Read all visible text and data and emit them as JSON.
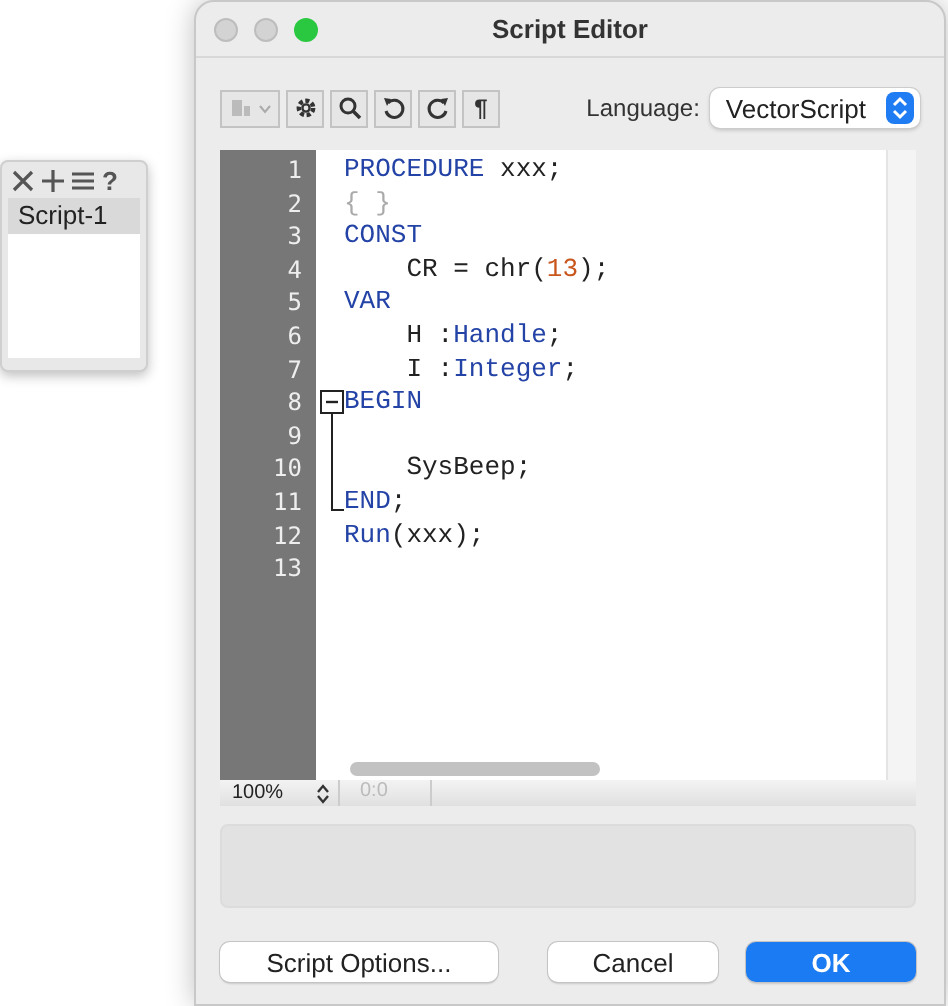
{
  "palette": {
    "help": "?",
    "items": [
      {
        "label": "Script-1",
        "selected": true
      }
    ]
  },
  "window": {
    "title": "Script Editor"
  },
  "toolbar": {
    "pilcrow": "¶",
    "language_label": "Language:",
    "language": "VectorScript"
  },
  "editor": {
    "lines": [
      {
        "number": "1",
        "kind": "plain",
        "tokens": [
          {
            "kind": "keyword",
            "text": "PROCEDURE"
          },
          {
            "kind": "plain",
            "text": " xxx;"
          }
        ]
      },
      {
        "number": "2",
        "kind": "plain",
        "tokens": [
          {
            "kind": "comment",
            "text": "{ }"
          }
        ]
      },
      {
        "number": "3",
        "kind": "plain",
        "tokens": [
          {
            "kind": "keyword",
            "text": "CONST"
          }
        ]
      },
      {
        "number": "4",
        "kind": "plain",
        "tokens": [
          {
            "kind": "plain",
            "text": "    CR = chr("
          },
          {
            "kind": "number",
            "text": "13"
          },
          {
            "kind": "plain",
            "text": ");"
          }
        ]
      },
      {
        "number": "5",
        "kind": "plain",
        "tokens": [
          {
            "kind": "keyword",
            "text": "VAR"
          }
        ]
      },
      {
        "number": "6",
        "kind": "plain",
        "tokens": [
          {
            "kind": "plain",
            "text": "    H :"
          },
          {
            "kind": "keyword",
            "text": "Handle"
          },
          {
            "kind": "plain",
            "text": ";"
          }
        ]
      },
      {
        "number": "7",
        "kind": "plain",
        "tokens": [
          {
            "kind": "plain",
            "text": "    I :"
          },
          {
            "kind": "keyword",
            "text": "Integer"
          },
          {
            "kind": "plain",
            "text": ";"
          }
        ]
      },
      {
        "number": "8",
        "kind": "foldstart",
        "tokens": [
          {
            "kind": "keyword",
            "text": "BEGIN"
          }
        ]
      },
      {
        "number": "9",
        "kind": "foldmiddle"
      },
      {
        "number": "10",
        "kind": "foldmiddle",
        "tokens": [
          {
            "kind": "plain",
            "text": "    SysBeep;"
          }
        ]
      },
      {
        "number": "11",
        "kind": "foldend",
        "tokens": [
          {
            "kind": "keyword",
            "text": "END"
          },
          {
            "kind": "plain",
            "text": ";"
          }
        ]
      },
      {
        "number": "12",
        "kind": "plain",
        "tokens": [
          {
            "kind": "keyword",
            "text": "Run"
          },
          {
            "kind": "plain",
            "text": "(xxx);"
          }
        ]
      },
      {
        "number": "13",
        "kind": "plain"
      }
    ],
    "zoom": "100%",
    "position": "0:0"
  },
  "buttons": [
    {
      "kind": "normal",
      "label": "Script Options..."
    },
    {
      "kind": "normal",
      "label": "Cancel"
    },
    {
      "kind": "default",
      "label": "OK"
    }
  ]
}
